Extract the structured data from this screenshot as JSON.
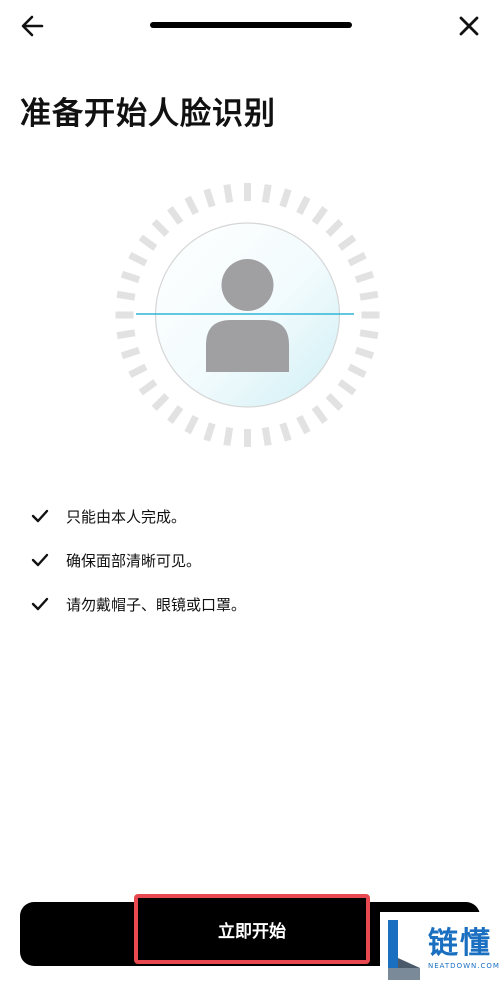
{
  "header": {
    "back_icon": "arrow-left-icon",
    "close_icon": "close-icon",
    "progress": 1.0
  },
  "title": "准备开始人脸识别",
  "face_graphic": {
    "icon": "user-silhouette-icon",
    "accent_color": "#2fb6d6",
    "ring_color": "#e2e2e2",
    "silhouette_color": "#a0a0a3"
  },
  "checklist": [
    {
      "icon": "check-icon",
      "text": "只能由本人完成。"
    },
    {
      "icon": "check-icon",
      "text": "确保面部清晰可见。"
    },
    {
      "icon": "check-icon",
      "text": "请勿戴帽子、眼镜或口罩。"
    }
  ],
  "actions": {
    "start_label": "立即开始",
    "highlight_color": "#e8484f"
  },
  "watermark": {
    "brand": "链懂",
    "site": "NEATDOWN.COM"
  }
}
